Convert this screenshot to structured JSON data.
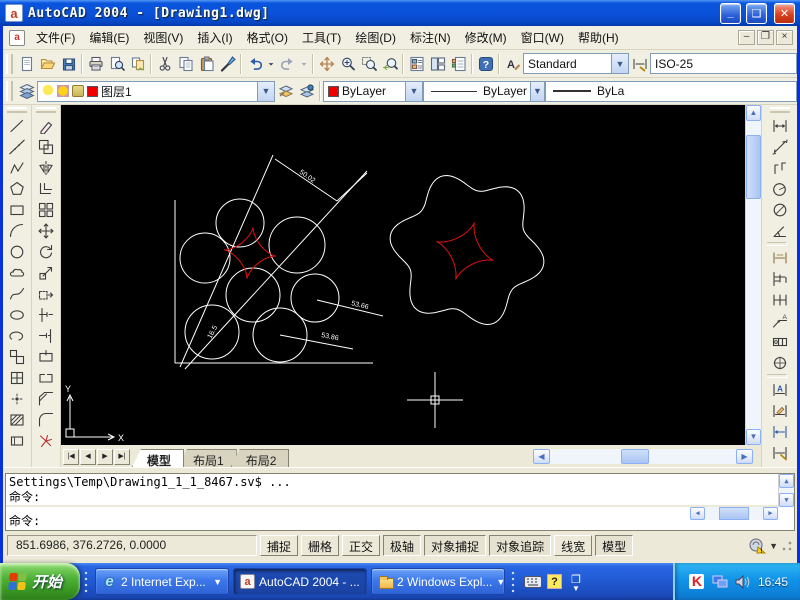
{
  "titlebar": {
    "title": "AutoCAD 2004 - [Drawing1.dwg]"
  },
  "menubar": {
    "items": [
      "文件(F)",
      "编辑(E)",
      "视图(V)",
      "插入(I)",
      "格式(O)",
      "工具(T)",
      "绘图(D)",
      "标注(N)",
      "修改(M)",
      "窗口(W)",
      "帮助(H)"
    ]
  },
  "standard_toolbar": {
    "icons": [
      "new",
      "open",
      "save",
      "separator",
      "print",
      "print-preview",
      "publish",
      "separator",
      "cut",
      "copy",
      "paste",
      "match-properties",
      "separator",
      "undo",
      "undo-dropdown",
      "redo",
      "redo-dropdown",
      "separator",
      "pan",
      "zoom-realtime",
      "zoom-window",
      "zoom-previous",
      "separator",
      "properties",
      "designcenter",
      "tool-palettes",
      "separator",
      "help"
    ]
  },
  "styles_toolbar": {
    "text_style_value": "Standard",
    "dim_style_value": "ISO-25"
  },
  "layers_toolbar": {
    "layer_value": "图层1"
  },
  "properties_toolbar": {
    "color_value": "ByLayer",
    "linetype_value": "ByLayer",
    "lineweight_value": "ByLa"
  },
  "draw_toolbar": {
    "icons": [
      "line",
      "construction-line",
      "polyline",
      "polygon",
      "rectangle",
      "arc",
      "circle",
      "revision-cloud",
      "spline",
      "ellipse",
      "ellipse-arc",
      "insert-block",
      "make-block",
      "point",
      "hatch",
      "region"
    ]
  },
  "modify_toolbar": {
    "icons": [
      "erase",
      "copy-object",
      "mirror",
      "offset",
      "array",
      "move",
      "rotate",
      "scale",
      "stretch",
      "trim",
      "extend",
      "break-at-point",
      "break",
      "chamfer",
      "fillet",
      "explode"
    ]
  },
  "dimension_toolbar": {
    "icons": [
      "linear",
      "aligned",
      "ordinate",
      "radius",
      "diameter",
      "angular",
      "separator",
      "quick-dimension",
      "baseline",
      "continue",
      "quick-leader",
      "tolerance",
      "center-mark",
      "separator",
      "dim-text-edit",
      "dim-edit",
      "dim-update",
      "dim-style"
    ]
  },
  "canvas": {
    "ucs_x": "X",
    "ucs_y": "Y",
    "dim_labels": {
      "top": "50.02",
      "leader1": "53.66",
      "leader2": "53.86",
      "small": "16.5"
    },
    "accent_red": "#e01010",
    "line_color": "#ffffff"
  },
  "tab_bar": {
    "tabs": [
      "模型",
      "布局1",
      "布局2"
    ],
    "active": "模型"
  },
  "command_window": {
    "history": [
      "Settings\\Temp\\Drawing1_1_1_8467.sv$ ...",
      "命令:"
    ],
    "input_prompt": "命令:"
  },
  "status_bar": {
    "coordinates": "851.6986,  376.2726, 0.0000",
    "toggles": [
      {
        "label": "捕捉",
        "active": false
      },
      {
        "label": "栅格",
        "active": false
      },
      {
        "label": "正交",
        "active": false
      },
      {
        "label": "极轴",
        "active": true
      },
      {
        "label": "对象捕捉",
        "active": true
      },
      {
        "label": "对象追踪",
        "active": true
      },
      {
        "label": "线宽",
        "active": false
      },
      {
        "label": "模型",
        "active": true
      }
    ]
  },
  "taskbar": {
    "start_label": "开始",
    "tasks": [
      {
        "label": "2 Internet Exp...",
        "icon": "ie-icon",
        "grouped": true,
        "active": false
      },
      {
        "label": "AutoCAD 2004 - ...",
        "icon": "autocad-icon",
        "grouped": false,
        "active": true
      },
      {
        "label": "2 Windows Expl...",
        "icon": "folder-icon",
        "grouped": true,
        "active": false
      }
    ],
    "clock": "16:45"
  }
}
